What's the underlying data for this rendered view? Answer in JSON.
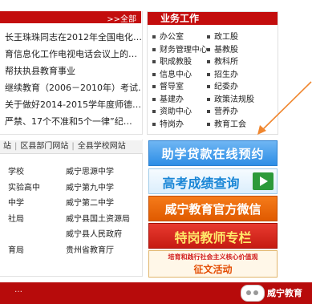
{
  "news": {
    "more_label": ">>全部",
    "items": [
      "长王珠珠同志在2012年全国电化…",
      "育信息化工作电视电话会议上的…",
      "帮扶执县教育事业",
      "继续教育（2006－2010年）考试…",
      "关于做好2014-2015学年度师德…",
      "严禁、17个不准和5个一律”纪…"
    ]
  },
  "business": {
    "title": "业务工作",
    "items": [
      "办公室",
      "政工股",
      "财务管理中心",
      "基教股",
      "职成教股",
      "教科所",
      "信息中心",
      "招生办",
      "督导室",
      "纪委办",
      "基建办",
      "政策法规股",
      "资助中心",
      "营养办",
      "特岗办",
      "教育工会"
    ]
  },
  "tabs": [
    "站",
    "区县部门网站",
    "全县学校网站"
  ],
  "links": [
    "学校",
    "威宁思源中学",
    "实验高中",
    "威宁第九中学",
    "中学",
    "威宁第二中学",
    "社局",
    "威宁县国土资源局",
    "",
    "威宁县人民政府",
    "育局",
    "贵州省教育厅"
  ],
  "banners": {
    "b1": "助学贷款在线预约",
    "b2": "高考成绩查询",
    "b3": "威宁教育官方微信",
    "b4": "特岗教师专栏",
    "b5_line1": "培育和践行社会主义核心价值观",
    "b5_line2": "征文活动"
  },
  "bottom_text": "…",
  "watermark_text": "威宁教育",
  "colors": {
    "header_red": "#c30d0d",
    "arrow_orange": "#f0862e"
  }
}
